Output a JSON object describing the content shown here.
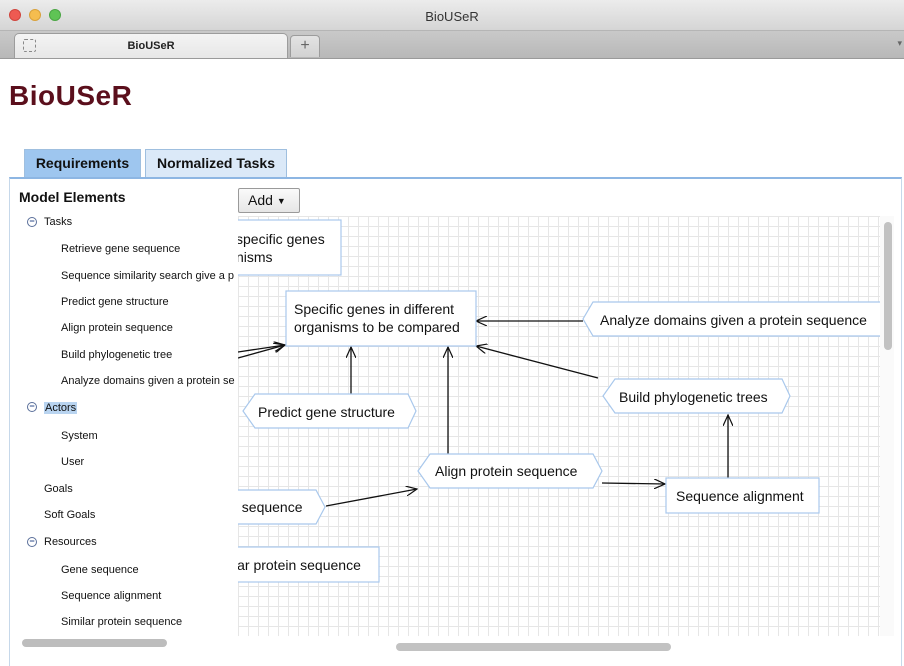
{
  "window": {
    "title": "BioUSeR"
  },
  "browser": {
    "tab_label": "BioUSeR",
    "new_tab": "+",
    "tab_menu": "▾"
  },
  "app": {
    "title": "BioUSeR"
  },
  "tabs": [
    {
      "label": "Requirements"
    },
    {
      "label": "Normalized Tasks"
    }
  ],
  "panel": {
    "title": "Model Elements",
    "toggle": "−",
    "tasks": {
      "label": "Tasks",
      "items": [
        "Retrieve gene sequence",
        "Sequence similarity search give a p",
        "Predict gene structure",
        "Align protein sequence",
        "Build phylogenetic tree",
        "Analyze domains given a protein se"
      ]
    },
    "actors": {
      "label": "Actors",
      "items": [
        "System",
        "User"
      ]
    },
    "goals": "Goals",
    "soft_goals": "Soft Goals",
    "resources": {
      "label": "Resources",
      "items": [
        "Gene sequence",
        "Sequence alignment",
        "Similar protein sequence"
      ]
    }
  },
  "toolbar": {
    "add_label": "Add"
  },
  "diagram": {
    "nodes": {
      "specific_genes_clipped": [
        "specific genes",
        "nisms"
      ],
      "specific_genes": [
        "Specific genes in different",
        "organisms to be compared"
      ],
      "analyze_domains": "Analyze domains given a protein sequence",
      "predict_gene_structure": "Predict gene structure",
      "build_phylogenetic_trees": "Build phylogenetic trees",
      "align_protein_sequence": "Align protein sequence",
      "sequence_alignment": "Sequence alignment",
      "sequence_clipped": "ı sequence",
      "similar_protein_clipped": "lar protein sequence"
    }
  },
  "colors": {
    "app_title": "#5b0f1c",
    "tab_active": "#9ec6ef",
    "tab_inactive": "#dbe9f8",
    "node_border": "#a9c8ec",
    "selection": "#b9d4f0"
  }
}
